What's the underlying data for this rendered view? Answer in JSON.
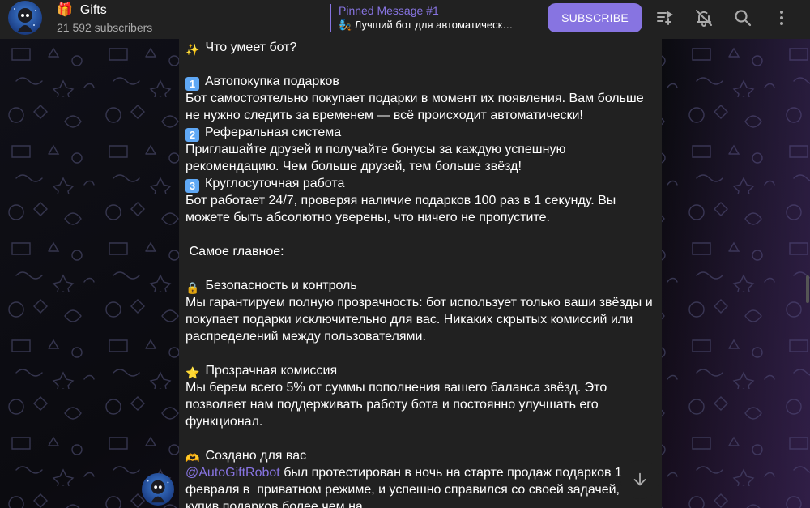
{
  "header": {
    "channel_emoji": "🎁",
    "channel_title": "Gifts",
    "subscribers": "21 592 subscribers",
    "pinned_title": "Pinned Message #1",
    "pinned_text": "🧞 Лучший бот для автоматическ…",
    "subscribe_label": "SUBSCRIBE",
    "icons": [
      "voice-chat-icon",
      "mute-icon",
      "search-icon",
      "more-icon"
    ]
  },
  "message": {
    "lines": [
      {
        "emoji": "✨",
        "text": "Что умеет бот?"
      },
      {
        "text": ""
      },
      {
        "emoji": "1",
        "text": "Автопокупка подарков"
      },
      {
        "text": "Бот самостоятельно покупает подарки в момент их появления. Вам больше"
      },
      {
        "text": "не нужно следить за временем — всё происходит автоматически!"
      },
      {
        "emoji": "2",
        "text": "Реферальная система"
      },
      {
        "text": "Приглашайте друзей и получайте бонусы за каждую успешную"
      },
      {
        "text": "рекомендацию. Чем больше друзей, тем больше звёзд!"
      },
      {
        "emoji": "3",
        "text": "Круглосуточная работа"
      },
      {
        "text": "Бот работает 24/7, проверяя наличие подарков 100 раз в 1 секунду. Вы"
      },
      {
        "text": "можете быть абсолютно уверены, что ничего не пропустите."
      },
      {
        "text": ""
      },
      {
        "text": " Самое главное:"
      },
      {
        "text": ""
      },
      {
        "emoji": "🔒",
        "text": "Безопасность и контроль"
      },
      {
        "text": "Мы гарантируем полную прозрачность: бот использует только ваши звёзды и"
      },
      {
        "text": "покупает подарки исключительно для вас. Никаких скрытых комиссий или"
      },
      {
        "text": "распределений между пользователями."
      },
      {
        "text": ""
      },
      {
        "emoji": "⭐",
        "text": "Прозрачная комиссия"
      },
      {
        "text": "Мы берем всего 5% от суммы пополнения вашего баланса звёзд. Это"
      },
      {
        "text": "позволяет нам поддерживать работу бота и постоянно улучшать его"
      },
      {
        "text": "функционал."
      },
      {
        "text": ""
      },
      {
        "emoji": "🫶",
        "text": "Создано для вас"
      },
      {
        "link": "@AutoGiftRobot",
        "text": " был протестирован в ночь на старте продаж подарков 1"
      },
      {
        "text": "февраля в  приватном режиме, и успешно справился со своей задачей,"
      },
      {
        "text": "купив подарков более чем на"
      }
    ]
  },
  "colors": {
    "accent": "#8774e1",
    "panel": "#212121",
    "background": "#0b0b0f"
  }
}
